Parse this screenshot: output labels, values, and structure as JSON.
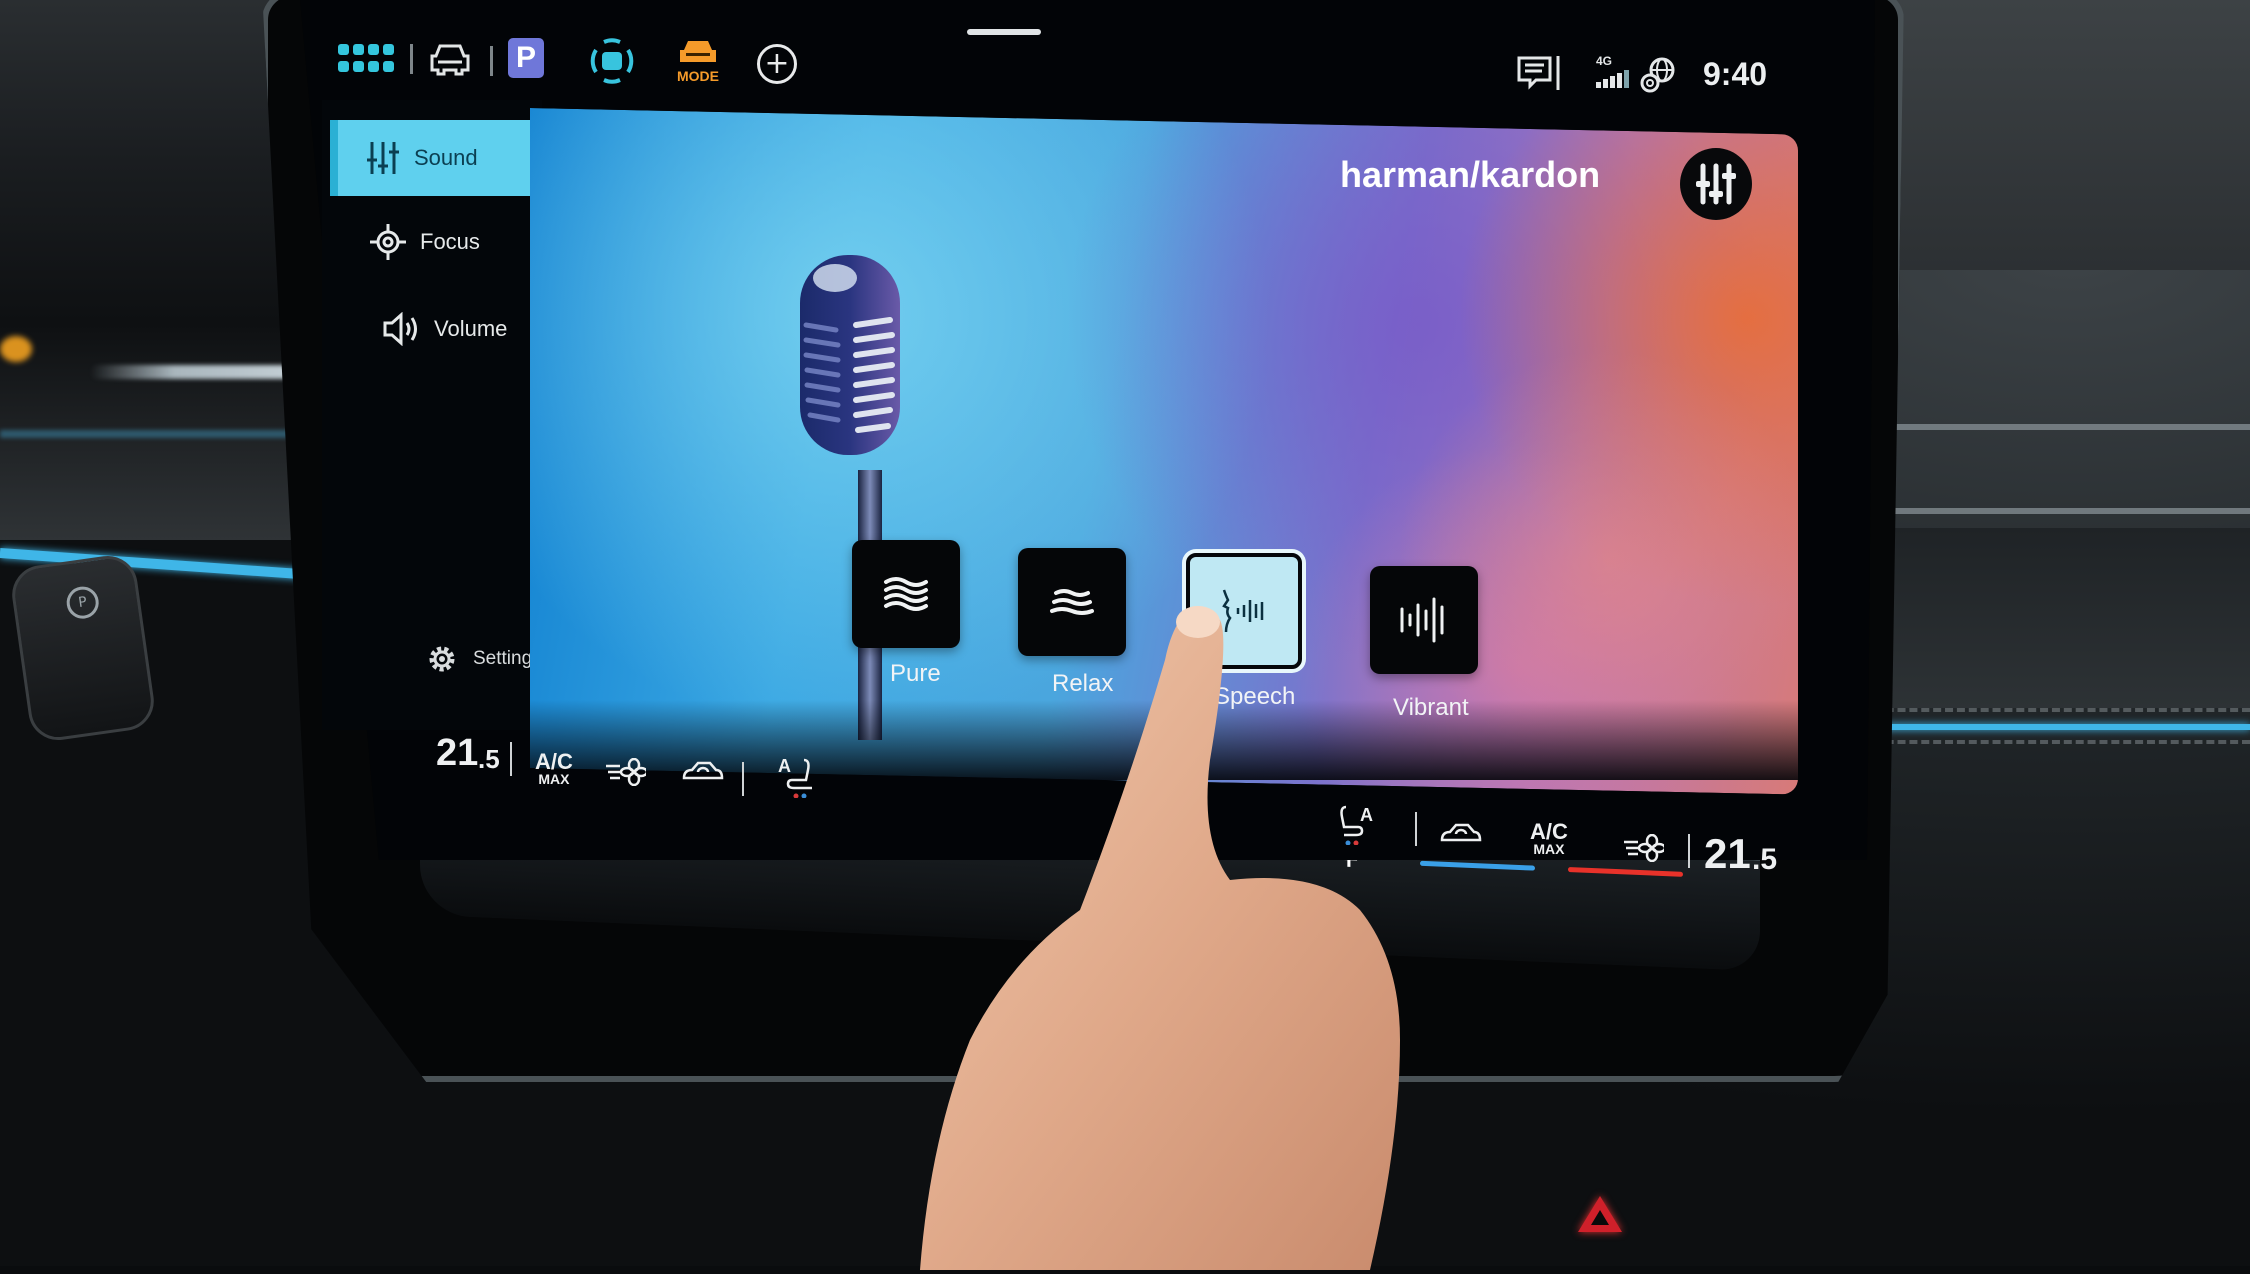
{
  "status_bar": {
    "icons": [
      "apps-grid-icon",
      "car-icon",
      "parking-icon",
      "park-assist-icon",
      "drive-mode-icon",
      "add-icon"
    ],
    "parking_label": "P",
    "mode_label": "MODE",
    "right_icons": [
      "message-icon",
      "signal-4g-icon",
      "globe-icon"
    ],
    "network_label": "4G",
    "time": "9:40"
  },
  "sidebar": {
    "items": [
      {
        "label": "Sound",
        "icon": "sliders-icon",
        "active": true
      },
      {
        "label": "Focus",
        "icon": "focus-icon",
        "active": false
      },
      {
        "label": "Volume",
        "icon": "speaker-icon",
        "active": false
      }
    ],
    "settings_label": "Settings"
  },
  "main": {
    "brand": "harman/kardon",
    "equalizer_button_icon": "equalizer-icon",
    "sound_modes": [
      {
        "label": "Pure",
        "icon": "waves-icon",
        "selected": false
      },
      {
        "label": "Relax",
        "icon": "relax-waves-icon",
        "selected": false
      },
      {
        "label": "Speech",
        "icon": "speech-icon",
        "selected": true
      },
      {
        "label": "Vibrant",
        "icon": "vibrant-bars-icon",
        "selected": false
      }
    ]
  },
  "climate": {
    "left": {
      "temp_whole": "21",
      "temp_decimal": ".5",
      "ac_label": "A/C",
      "ac_sub": "MAX",
      "seat_label": "A"
    },
    "right": {
      "temp_whole": "21",
      "temp_decimal": ".5",
      "ac_label": "A/C",
      "ac_sub": "MAX",
      "seat_label": "A"
    }
  },
  "physical_controls": {
    "plus_label": "+",
    "cold_color": "#3aa0e8",
    "hot_color": "#e8322a"
  },
  "colors": {
    "accent": "#5fd0ee",
    "mode_orange": "#f59b2a",
    "parking_purple": "#6f77d9"
  }
}
